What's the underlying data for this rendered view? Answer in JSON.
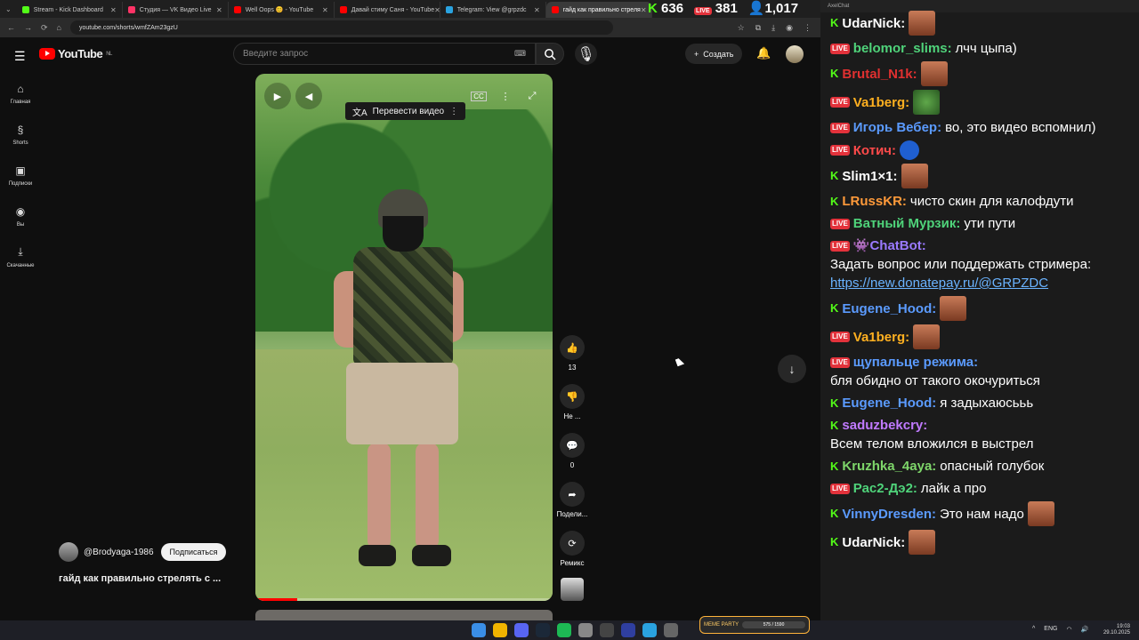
{
  "browser": {
    "tabs": [
      {
        "label": "Stream - Kick Dashboard",
        "color": "#53fc18"
      },
      {
        "label": "Студия — VK Видео Live",
        "color": "#ff3366"
      },
      {
        "label": "Well Oops 😊 - YouTube",
        "color": "#ff0000"
      },
      {
        "label": "Давай стиму Саня - YouTube",
        "color": "#ff0000"
      },
      {
        "label": "Telegram: View @grpzdc",
        "color": "#2aa3e0"
      },
      {
        "label": "гайд как правильно стреля",
        "color": "#ff0000"
      }
    ],
    "url": "youtube.com/shorts/wmfZAm23gzU"
  },
  "stats": {
    "kick": "636",
    "vk": "381",
    "viewers": "1,017",
    "live_badge": "LIVE"
  },
  "youtube": {
    "logo": "YouTube",
    "region": "NL",
    "search_placeholder": "Введите запрос",
    "create_label": "Создать",
    "sidebar": [
      {
        "label": "Главная",
        "icon": "⌂"
      },
      {
        "label": "Shorts",
        "icon": "§"
      },
      {
        "label": "Подписки",
        "icon": "▣"
      },
      {
        "label": "Вы",
        "icon": "◉"
      },
      {
        "label": "Скачанные",
        "icon": "⤓"
      }
    ],
    "translate_label": "Перевести видео",
    "actions": [
      {
        "icon": "👍",
        "label": "13"
      },
      {
        "icon": "👎",
        "label": "Не ..."
      },
      {
        "icon": "💬",
        "label": "0"
      },
      {
        "icon": "➦",
        "label": "Подели..."
      },
      {
        "icon": "⟳",
        "label": "Ремикс"
      }
    ],
    "channel": "@Brodyaga-1986",
    "subscribe_label": "Подписаться",
    "video_title": "гайд как правильно стрелять с ...",
    "progress": 0.14
  },
  "chat": {
    "title": "AxelChat",
    "messages": [
      {
        "platform": "kick",
        "nick": "UdarNick:",
        "color": "#ffffff",
        "text": "",
        "emote": "pepe"
      },
      {
        "platform": "vk",
        "nick": "belomor_slims:",
        "color": "#4fd37a",
        "text": "лчч цыпа)",
        "emote": ""
      },
      {
        "platform": "kick",
        "nick": "Brutal_N1k:",
        "color": "#e03030",
        "text": "",
        "emote": "pepe"
      },
      {
        "platform": "vk",
        "nick": "Va1berg:",
        "color": "#ffb020",
        "text": "",
        "emote": "frog"
      },
      {
        "platform": "vk",
        "nick": "Игорь Вебер:",
        "color": "#5b9bff",
        "text": "во, это видео вспомнил)",
        "emote": ""
      },
      {
        "platform": "vk",
        "nick": "Котич:",
        "color": "#ff4a4a",
        "text": "",
        "emote": "blue"
      },
      {
        "platform": "kick",
        "nick": "Slim1×1:",
        "color": "#ffffff",
        "text": "",
        "emote": "pepe"
      },
      {
        "platform": "kick",
        "nick": "LRussKR:",
        "color": "#ff9a3a",
        "text": "чисто скин для калофдути",
        "emote": ""
      },
      {
        "platform": "vk",
        "nick": "Ватный Мурзик:",
        "color": "#4fd37a",
        "text": "ути пути",
        "emote": ""
      },
      {
        "platform": "vk",
        "nick": "👾ChatBot:",
        "color": "#9a7aff",
        "text": "Задать вопрос или поддержать стримера:",
        "emote": "",
        "link": "https://new.donatepay.ru/@GRPZDC"
      },
      {
        "platform": "kick",
        "nick": "Eugene_Hood:",
        "color": "#5b9bff",
        "text": "",
        "emote": "pepe"
      },
      {
        "platform": "vk",
        "nick": "Va1berg:",
        "color": "#ffb020",
        "text": "",
        "emote": "pepe"
      },
      {
        "platform": "vk",
        "nick": "щупальце режима:",
        "color": "#5b9bff",
        "text": "бля обидно от такого окочуриться",
        "emote": ""
      },
      {
        "platform": "kick",
        "nick": "Eugene_Hood:",
        "color": "#5b9bff",
        "text": "я задыхаюсььь",
        "emote": ""
      },
      {
        "platform": "kick",
        "nick": "saduzbekcry:",
        "color": "#c07aff",
        "text": "Всем телом вложился в выстрел",
        "emote": ""
      },
      {
        "platform": "kick",
        "nick": "Kruzhka_4aya:",
        "color": "#7ed66a",
        "text": "опасный голубок",
        "emote": ""
      },
      {
        "platform": "vk",
        "nick": "Рас2-Дэ2:",
        "color": "#4fd37a",
        "text": "лайк а про",
        "emote": ""
      },
      {
        "platform": "kick",
        "nick": "VinnyDresden:",
        "color": "#5b9bff",
        "text": "Это нам надо",
        "emote": "pepe"
      },
      {
        "platform": "kick",
        "nick": "UdarNick:",
        "color": "#ffffff",
        "text": "",
        "emote": "pepe"
      }
    ]
  },
  "taskbar": {
    "lang": "ENG",
    "time": "19:03",
    "date": "29.10.2025",
    "meme_label": "MEME PARTY",
    "meme_progress": "575 / 1590"
  }
}
